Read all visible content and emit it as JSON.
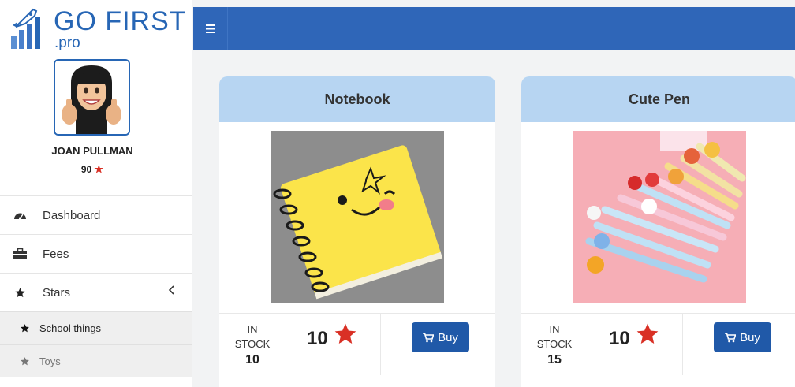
{
  "brand": {
    "name": "GO FIRST",
    "suffix": ".pro"
  },
  "user": {
    "name": "JOAN PULLMAN",
    "stars": "90"
  },
  "nav": {
    "dashboard": "Dashboard",
    "fees": "Fees",
    "stars": "Stars",
    "school_things": "School things",
    "toys": "Toys"
  },
  "colors": {
    "topbar": "#2f66b8",
    "card_header": "#b7d5f2",
    "buy_button": "#2059a8",
    "star": "#d93025"
  },
  "products": [
    {
      "title": "Notebook",
      "stock_label_1": "IN",
      "stock_label_2": "STOCK",
      "stock": "10",
      "stars": "10",
      "buy": "Buy"
    },
    {
      "title": "Cute Pen",
      "stock_label_1": "IN",
      "stock_label_2": "STOCK",
      "stock": "15",
      "stars": "10",
      "buy": "Buy"
    }
  ]
}
